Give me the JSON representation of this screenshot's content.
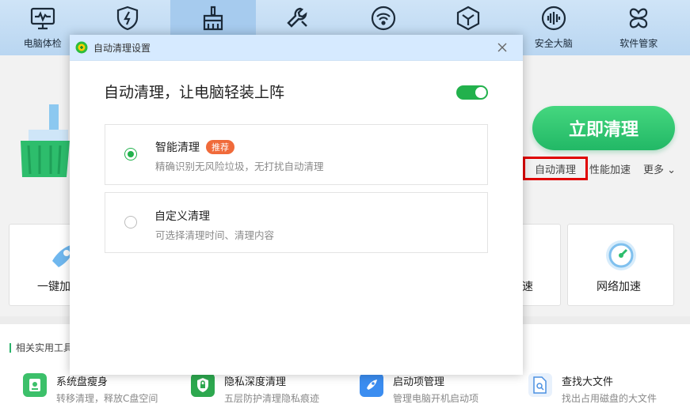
{
  "nav": {
    "items": [
      {
        "label": "电脑体检",
        "icon": "monitor-pulse-icon"
      },
      {
        "label": "",
        "icon": "shield-bolt-icon"
      },
      {
        "label": "",
        "icon": "broom-icon",
        "active": true
      },
      {
        "label": "",
        "icon": "wrench-icon"
      },
      {
        "label": "",
        "icon": "wifi-icon"
      },
      {
        "label": "",
        "icon": "cube-icon"
      },
      {
        "label": "安全大脑",
        "icon": "soundwave-icon"
      },
      {
        "label": "软件管家",
        "icon": "grid-flower-icon"
      }
    ]
  },
  "main": {
    "clean_button": "立即清理",
    "link_auto_clean": "自动清理",
    "link_perf_boost": "性能加速",
    "link_more": "更多",
    "card_left_caption": "一键加",
    "card_mid_caption": "速",
    "card_net_caption": "网络加速"
  },
  "tools": {
    "title": "相关实用工具",
    "items": [
      {
        "name": "系统盘瘦身",
        "desc": "转移清理，释放C盘空间",
        "icon": "disk-icon",
        "color": "#3cc06a"
      },
      {
        "name": "隐私深度清理",
        "desc": "五层防护清理隐私痕迹",
        "icon": "shield-lock-icon",
        "color": "#2da84f"
      },
      {
        "name": "启动项管理",
        "desc": "管理电脑开机启动项",
        "icon": "rocket-icon",
        "color": "#3b8df0"
      },
      {
        "name": "查找大文件",
        "desc": "找出占用磁盘的大文件",
        "icon": "file-search-icon",
        "color": "#4a90e2"
      }
    ]
  },
  "modal": {
    "title": "自动清理设置",
    "heading": "自动清理，让电脑轻装上阵",
    "toggle_on": true,
    "options": [
      {
        "name": "智能清理",
        "badge": "推荐",
        "desc": "精确识别无风险垃圾，无打扰自动清理",
        "selected": true
      },
      {
        "name": "自定义清理",
        "desc": "可选择清理时间、清理内容",
        "selected": false
      }
    ]
  },
  "colors": {
    "accent_green": "#22b14c",
    "highlight_red": "#e00000",
    "badge_orange": "#f06a3a"
  }
}
